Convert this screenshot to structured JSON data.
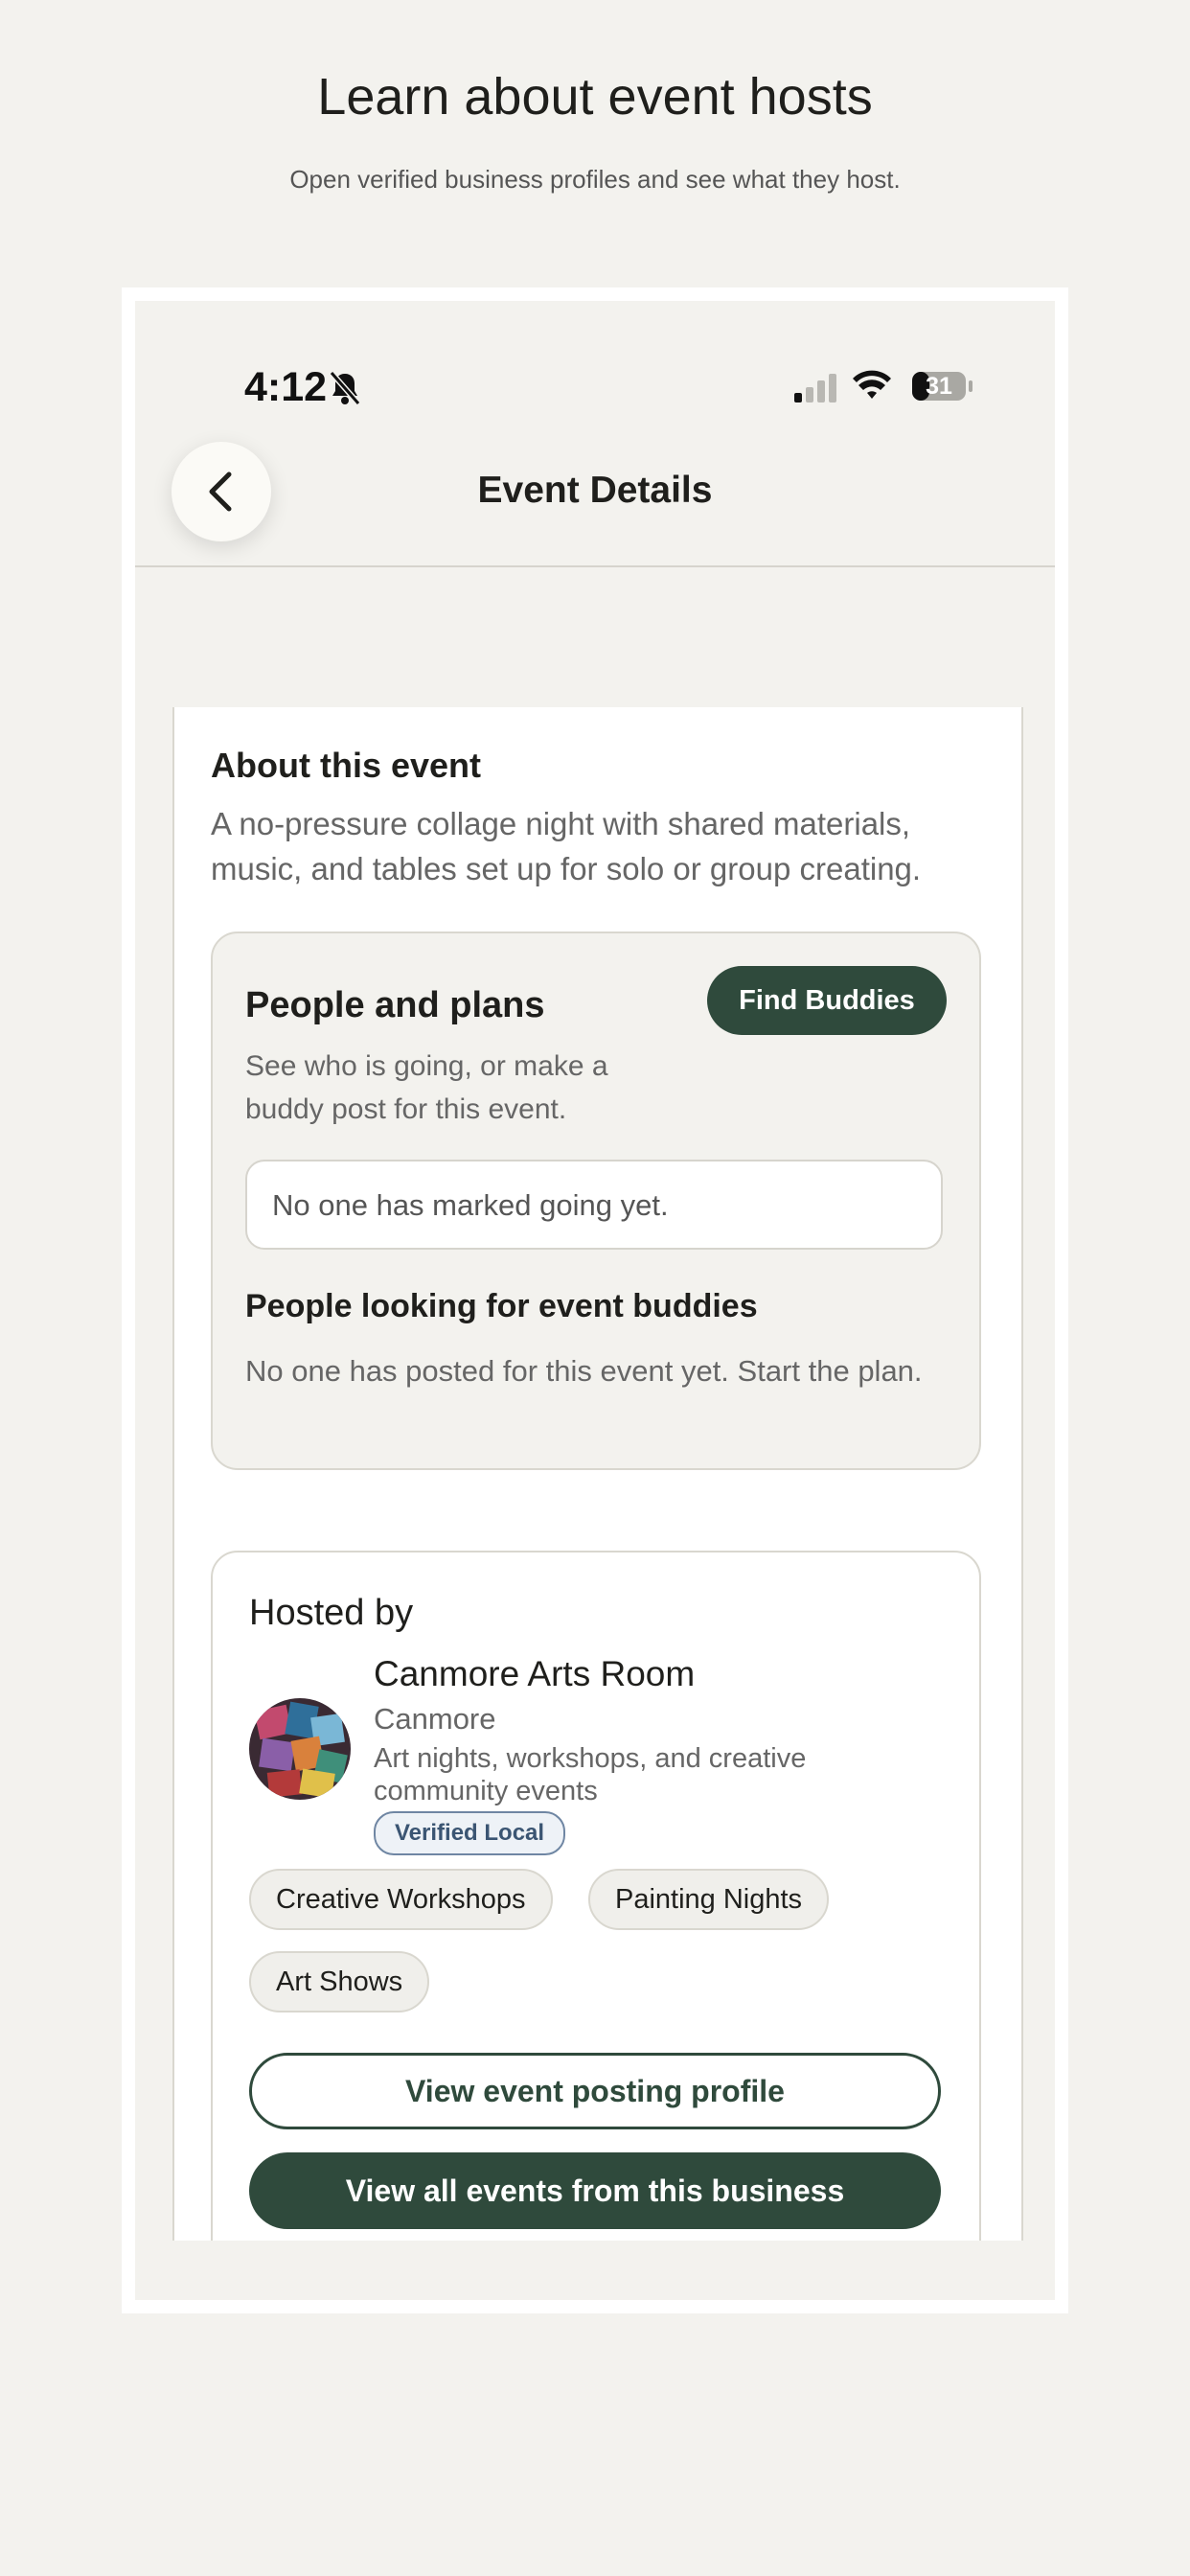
{
  "hero": {
    "title": "Learn about event hosts",
    "subtitle": "Open verified business profiles and see what they host."
  },
  "status_bar": {
    "time": "4:12",
    "battery": "31",
    "icons": [
      "bell-slash-icon",
      "signal-icon",
      "wifi-icon",
      "battery-icon"
    ]
  },
  "nav": {
    "title": "Event Details",
    "back_icon": "chevron-left-icon"
  },
  "about": {
    "title": "About this event",
    "description": "A no-pressure collage night with shared materials, music, and tables set up for solo or group creating."
  },
  "people": {
    "title": "People and plans",
    "description": "See who is going, or make a buddy post for this event.",
    "find_buddies_label": "Find Buddies",
    "going_status": "No one has marked going yet.",
    "buddies_title": "People looking for event buddies",
    "buddies_empty": "No one has posted for this event yet. Start the plan."
  },
  "host": {
    "section_title": "Hosted by",
    "name": "Canmore Arts Room",
    "city": "Canmore",
    "description": "Art nights, workshops, and creative community events",
    "badge": "Verified Local",
    "tags": [
      "Creative Workshops",
      "Painting Nights",
      "Art Shows"
    ],
    "view_profile_label": "View event posting profile",
    "view_all_label": "View all events from this business"
  },
  "colors": {
    "background": "#f3f2ee",
    "accent": "#2f4a3c",
    "badge_border": "#6f86a3"
  }
}
